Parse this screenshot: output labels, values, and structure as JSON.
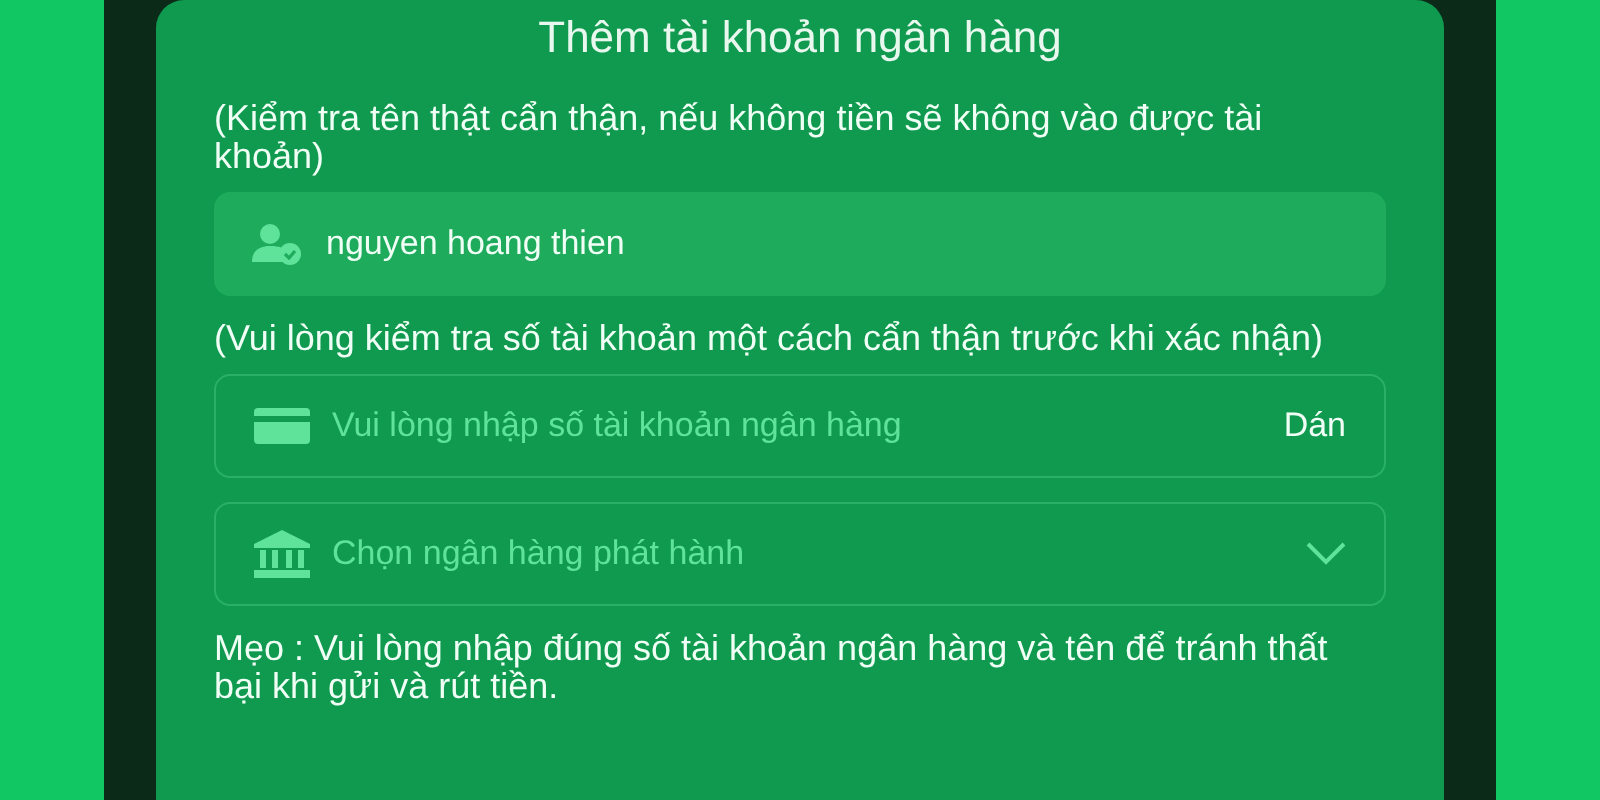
{
  "title": "Thêm tài khoản ngân hàng",
  "name_hint": "(Kiểm tra tên thật cẩn thận, nếu không tiền sẽ không vào được tài khoản)",
  "name_field": {
    "value": "nguyen hoang thien"
  },
  "account_hint": "(Vui lòng kiểm tra số tài khoản một cách cẩn thận trước khi xác nhận)",
  "account_field": {
    "placeholder": "Vui lòng nhập số tài khoản ngân hàng",
    "paste_button": "Dán"
  },
  "bank_select": {
    "placeholder": "Chọn ngân hàng phát hành"
  },
  "tip": "Mẹo :  Vui lòng nhập đúng số tài khoản ngân hàng và tên để tránh thất bại khi gửi và rút tiền."
}
